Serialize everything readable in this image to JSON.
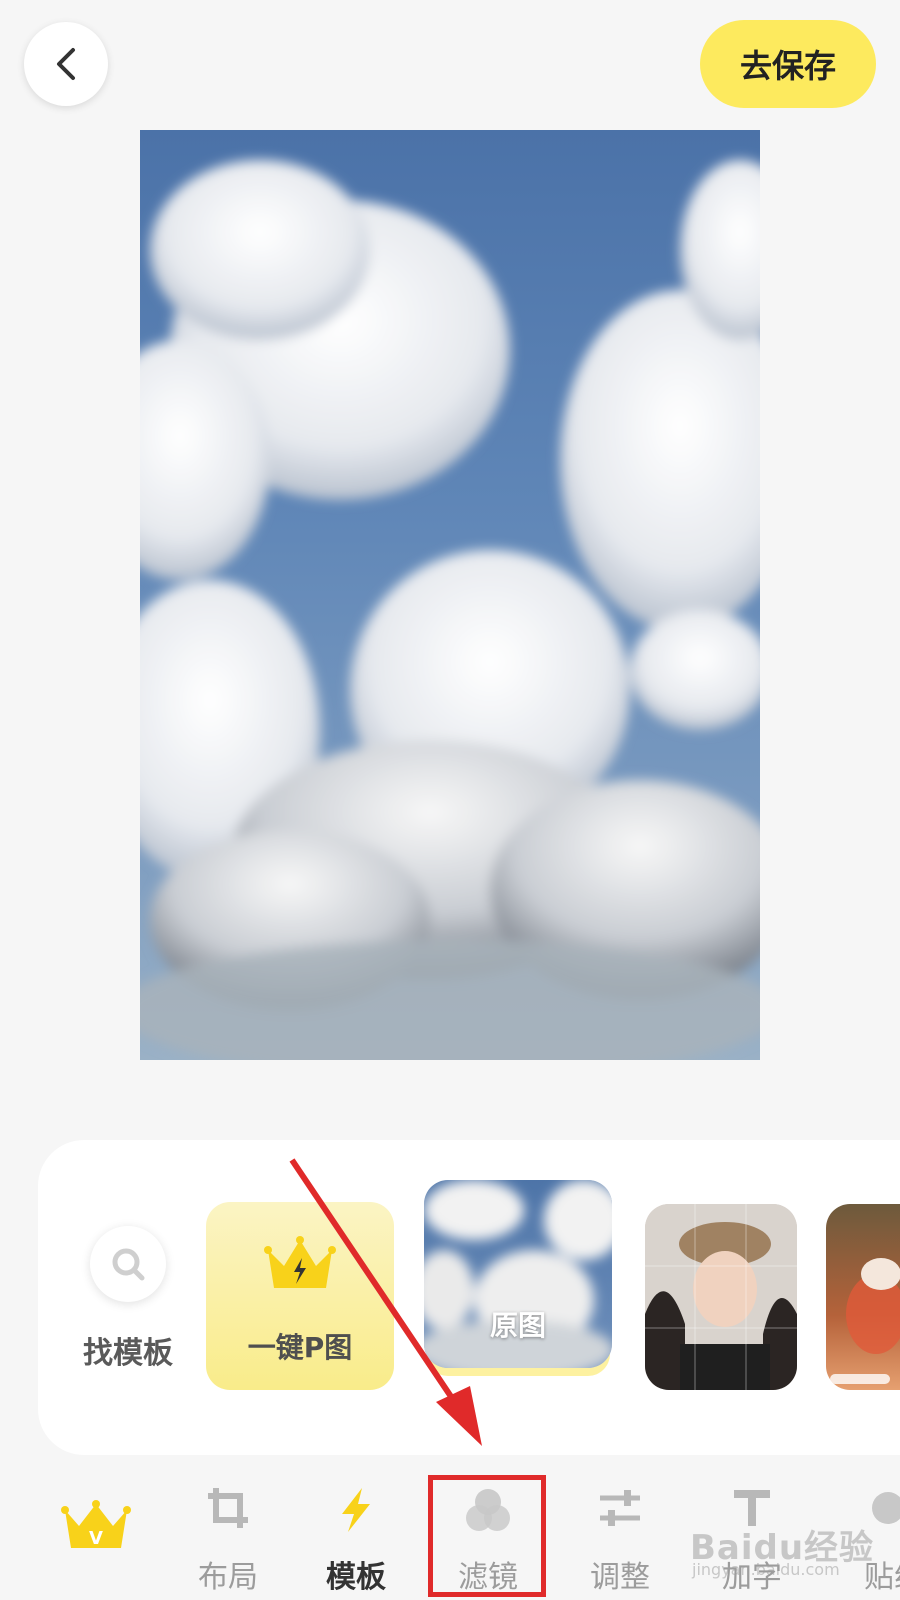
{
  "header": {
    "back_icon": "chevron-left-icon",
    "save_label": "去保存"
  },
  "panel": {
    "find_template_label": "找模板",
    "find_template_icon": "search-icon",
    "onekey_label": "一键P图",
    "onekey_icon": "crown-lightning-icon",
    "original_label": "原图"
  },
  "toolbar": {
    "items": [
      {
        "label": "",
        "icon": "crown-v-icon"
      },
      {
        "label": "布局",
        "icon": "crop-icon"
      },
      {
        "label": "模板",
        "icon": "lightning-icon",
        "active": true
      },
      {
        "label": "滤镜",
        "icon": "filter-circles-icon"
      },
      {
        "label": "调整",
        "icon": "sliders-icon"
      },
      {
        "label": "加字",
        "icon": "text-icon"
      },
      {
        "label": "贴纸",
        "icon": "sticker-icon"
      }
    ]
  },
  "watermark": {
    "text": "Baidu经验",
    "sub": "jingyan.baidu.com"
  },
  "colors": {
    "accent_yellow": "#fdea5e",
    "highlight_red": "#e02a2a"
  }
}
